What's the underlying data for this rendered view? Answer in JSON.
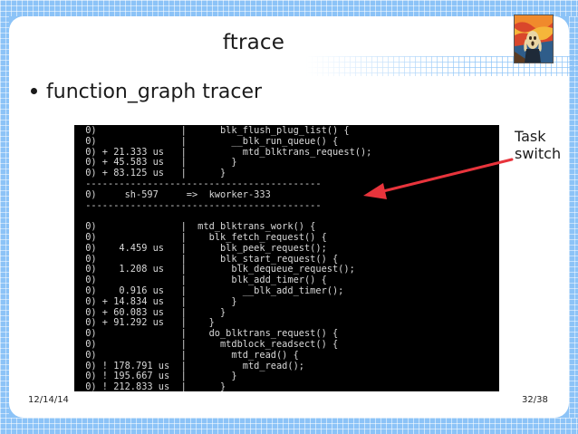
{
  "slide": {
    "title": "ftrace",
    "bullet": "function_graph tracer",
    "annotation": {
      "line1": "Task",
      "line2": "switch",
      "arrow_color": "#e8343c"
    },
    "footer": {
      "date": "12/14/14",
      "page": "32/38"
    }
  },
  "terminal": {
    "lines": [
      " 0)               |      blk_flush_plug_list() {",
      " 0)               |        __blk_run_queue() {",
      " 0) + 21.333 us   |          mtd_blktrans_request();",
      " 0) + 45.583 us   |        }",
      " 0) + 83.125 us   |      }",
      " ------------------------------------------",
      " 0)     sh-597     =>  kworker-333",
      " ------------------------------------------",
      "",
      " 0)               |  mtd_blktrans_work() {",
      " 0)               |    blk_fetch_request() {",
      " 0)    4.459 us   |      blk_peek_request();",
      " 0)               |      blk_start_request() {",
      " 0)    1.208 us   |        blk_dequeue_request();",
      " 0)               |        blk_add_timer() {",
      " 0)    0.916 us   |          __blk_add_timer();",
      " 0) + 14.834 us   |        }",
      " 0) + 60.083 us   |      }",
      " 0) + 91.292 us   |    }",
      " 0)               |    do_blktrans_request() {",
      " 0)               |      mtdblock_readsect() {",
      " 0)               |        mtd_read() {",
      " 0) ! 178.791 us  |          mtd_read();",
      " 0) ! 195.667 us  |        }",
      " 0) ! 212.833 us  |      }"
    ]
  },
  "colors": {
    "frame_blue": "#8cc3f7",
    "terminal_bg": "#000000",
    "terminal_fg": "#d8d8d8"
  }
}
